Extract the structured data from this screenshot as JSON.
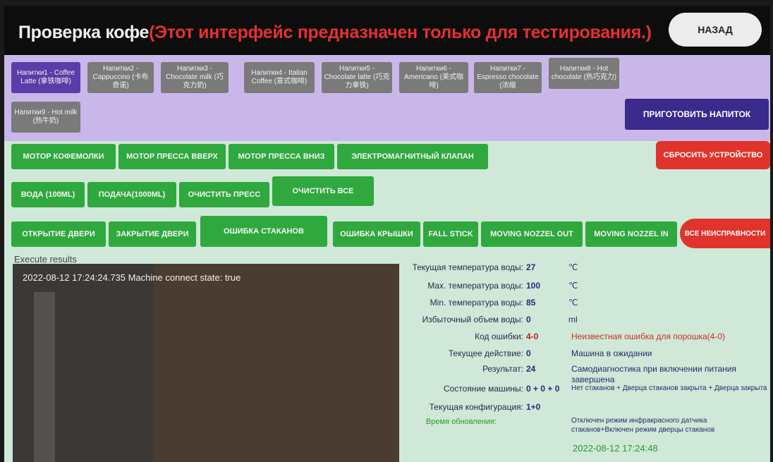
{
  "header": {
    "title": "Проверка кофе",
    "warning": "(Этот интерфейс предназначен только для тестирования.)",
    "back_label": "НАЗАД"
  },
  "drinks": [
    {
      "label": "Напитки1 - Coffee Latte (拿铁咖啡)",
      "selected": true
    },
    {
      "label": "Напитки2 - Cappuccino (卡布奇诺)",
      "selected": false
    },
    {
      "label": "Напитки3 - Chocolate milk (巧克力奶)",
      "selected": false
    },
    {
      "label": "Напитки4 - Italian Coffee (意式咖啡)",
      "selected": false
    },
    {
      "label": "Напитки5 - Chocolate latte (巧克力拿铁)",
      "selected": false
    },
    {
      "label": "Напитки6 - Americano (美式咖啡)",
      "selected": false
    },
    {
      "label": "Напитки7 - Espresso chocolate (浓缩",
      "selected": false
    },
    {
      "label": "Напитки8 - Hot chocolate (热巧克力)",
      "selected": false
    },
    {
      "label": "Напитки9 - Hot milk (热牛奶)",
      "selected": false
    }
  ],
  "make_drink_label": "ПРИГОТОВИТЬ НАПИТОК",
  "controls": {
    "row1": [
      "МОТОР КОФЕМОЛКИ",
      "МОТОР ПРЕССА ВВЕРХ",
      "МОТОР ПРЕССА ВНИЗ",
      "ЭЛЕКТРОМАГНИТНЫЙ КЛАПАН"
    ],
    "reset_label": "СБРОСИТЬ УСТРОЙСТВО",
    "row2": [
      "ВОДА (100ML)",
      "ПОДАЧА(1000ML)",
      "ОЧИСТИТЬ ПРЕСС",
      "ОЧИСТИТЬ ВСЕ"
    ],
    "row3": [
      "ОТКРЫТИЕ ДВЕРИ",
      "ЗАКРЫТИЕ ДВЕРИ",
      "ОШИБКА СТАКАНОВ",
      "ОШИБКА КРЫШКИ",
      "FALL STICK",
      "MOVING NOZZEL OUT",
      "MOVING NOZZEL IN"
    ],
    "all_faults_label": "ВСЕ НЕИСПРАВНОСТИ"
  },
  "results": {
    "label": "Execute results",
    "line": "2022-08-12 17:24:24.735  Machine connect state: true"
  },
  "status": [
    {
      "label": "Текущая температура воды:",
      "value": "27",
      "desc": "℃",
      "desc_style": ""
    },
    {
      "label": "Max. температура воды:",
      "value": "100",
      "desc": "℃",
      "desc_style": ""
    },
    {
      "label": "Min. температура воды:",
      "value": "85",
      "desc": "℃",
      "desc_style": ""
    },
    {
      "label": "Избыточный объем воды:",
      "value": "0",
      "desc": "ml",
      "desc_style": ""
    },
    {
      "label": "Код ошибки:",
      "value": "4-0",
      "desc": "Неизвестная ошибка для порошка(4-0)",
      "desc_style": "red"
    },
    {
      "label": "Текущее действие:",
      "value": "0",
      "desc": "Машина в ожидании",
      "desc_style": ""
    },
    {
      "label": "Результат:",
      "value": "24",
      "desc": "Самодиагностика при включении питания завершена",
      "desc_style": ""
    },
    {
      "label": "Состояние машины:",
      "value": "0 + 0 + 0",
      "desc": "Нет стаканов + Дверца стаканов закрыта + Дверца закрыта",
      "desc_style": ""
    },
    {
      "label": "Текущая конфигурация:",
      "value": "1+0",
      "desc": "Отключен режим инфракрасного датчика стаканов+Включен режим дверцы стаканов",
      "desc_style": ""
    }
  ],
  "update": {
    "label": "Время обновления:",
    "value": "2022-08-12 17:24:48"
  },
  "colors": {
    "header_bg": "#0d0d0d",
    "warning_red": "#e53030",
    "drinks_bg": "#c9b7ea",
    "drink_selected": "#5a3da8",
    "drink_default": "#7a7a7a",
    "make_button": "#3a2a8c",
    "control_green": "#2fa83d",
    "reset_red": "#e0332c"
  }
}
